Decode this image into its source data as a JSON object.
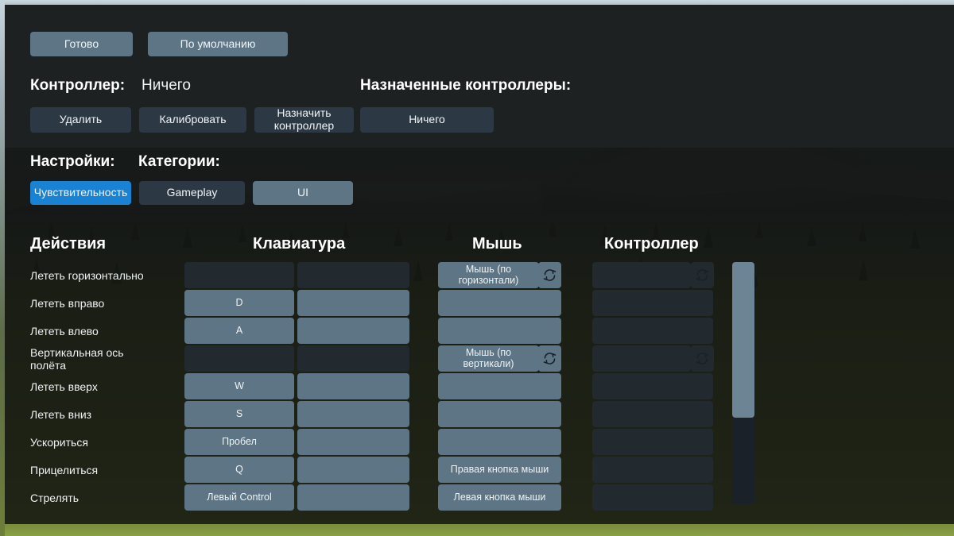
{
  "toolbar": {
    "done_label": "Готово",
    "defaults_label": "По умолчанию"
  },
  "controller_section": {
    "label": "Контроллер:",
    "value": "Ничего",
    "delete_label": "Удалить",
    "calibrate_label": "Калибровать",
    "assign_label": "Назначить\nконтроллер",
    "assigned_label": "Назначенные контроллеры:",
    "assigned_value": "Ничего"
  },
  "settings_section": {
    "settings_label": "Настройки:",
    "categories_label": "Категории:",
    "categories": [
      {
        "label": "Чувствительность",
        "state": "accent"
      },
      {
        "label": "Gameplay",
        "state": "dark"
      },
      {
        "label": "UI",
        "state": "light"
      }
    ]
  },
  "table": {
    "headers": {
      "actions": "Действия",
      "keyboard": "Клавиатура",
      "mouse": "Мышь",
      "controller": "Контроллер"
    },
    "rows": [
      {
        "action": "Лететь горизонтально",
        "kb1": {
          "text": "",
          "state": "dark"
        },
        "kb2": {
          "text": "",
          "state": "dark"
        },
        "mouse": {
          "text": "Мышь (по\nгоризонтали)",
          "state": "light",
          "invert": true
        },
        "controller": {
          "text": "",
          "state": "dark",
          "invert": true
        }
      },
      {
        "action": "Лететь вправо",
        "kb1": {
          "text": "D",
          "state": "light"
        },
        "kb2": {
          "text": "",
          "state": "light"
        },
        "mouse": {
          "text": "",
          "state": "light",
          "invert": false
        },
        "controller": {
          "text": "",
          "state": "dark",
          "invert": false
        }
      },
      {
        "action": "Лететь влево",
        "kb1": {
          "text": "A",
          "state": "light"
        },
        "kb2": {
          "text": "",
          "state": "light"
        },
        "mouse": {
          "text": "",
          "state": "light",
          "invert": false
        },
        "controller": {
          "text": "",
          "state": "dark",
          "invert": false
        }
      },
      {
        "action": "Вертикальная ось\nполёта",
        "kb1": {
          "text": "",
          "state": "dark"
        },
        "kb2": {
          "text": "",
          "state": "dark"
        },
        "mouse": {
          "text": "Мышь (по\nвертикали)",
          "state": "light",
          "invert": true
        },
        "controller": {
          "text": "",
          "state": "dark",
          "invert": true
        }
      },
      {
        "action": "Лететь вверх",
        "kb1": {
          "text": "W",
          "state": "light"
        },
        "kb2": {
          "text": "",
          "state": "light"
        },
        "mouse": {
          "text": "",
          "state": "light",
          "invert": false
        },
        "controller": {
          "text": "",
          "state": "dark",
          "invert": false
        }
      },
      {
        "action": "Лететь вниз",
        "kb1": {
          "text": "S",
          "state": "light"
        },
        "kb2": {
          "text": "",
          "state": "light"
        },
        "mouse": {
          "text": "",
          "state": "light",
          "invert": false
        },
        "controller": {
          "text": "",
          "state": "dark",
          "invert": false
        }
      },
      {
        "action": "Ускориться",
        "kb1": {
          "text": "Пробел",
          "state": "light"
        },
        "kb2": {
          "text": "",
          "state": "light"
        },
        "mouse": {
          "text": "",
          "state": "light",
          "invert": false
        },
        "controller": {
          "text": "",
          "state": "dark",
          "invert": false
        }
      },
      {
        "action": "Прицелиться",
        "kb1": {
          "text": "Q",
          "state": "light"
        },
        "kb2": {
          "text": "",
          "state": "light"
        },
        "mouse": {
          "text": "Правая кнопка мыши",
          "state": "light",
          "invert": false
        },
        "controller": {
          "text": "",
          "state": "dark",
          "invert": false
        }
      },
      {
        "action": "Стрелять",
        "kb1": {
          "text": "Левый Control",
          "state": "light"
        },
        "kb2": {
          "text": "",
          "state": "light"
        },
        "mouse": {
          "text": "Левая кнопка мыши",
          "state": "light",
          "invert": false
        },
        "controller": {
          "text": "",
          "state": "dark",
          "invert": false
        }
      }
    ]
  },
  "scrollbar": {
    "name": "bindings-scrollbar"
  },
  "colors": {
    "accent": "#1a82d2",
    "button_light": "#5d7585",
    "button_dark": "#2c3945",
    "bind_dark": "#22292f",
    "panel": "#1e2122",
    "text": "#ffffff"
  },
  "icons": {
    "invert": "refresh-invert-icon"
  }
}
